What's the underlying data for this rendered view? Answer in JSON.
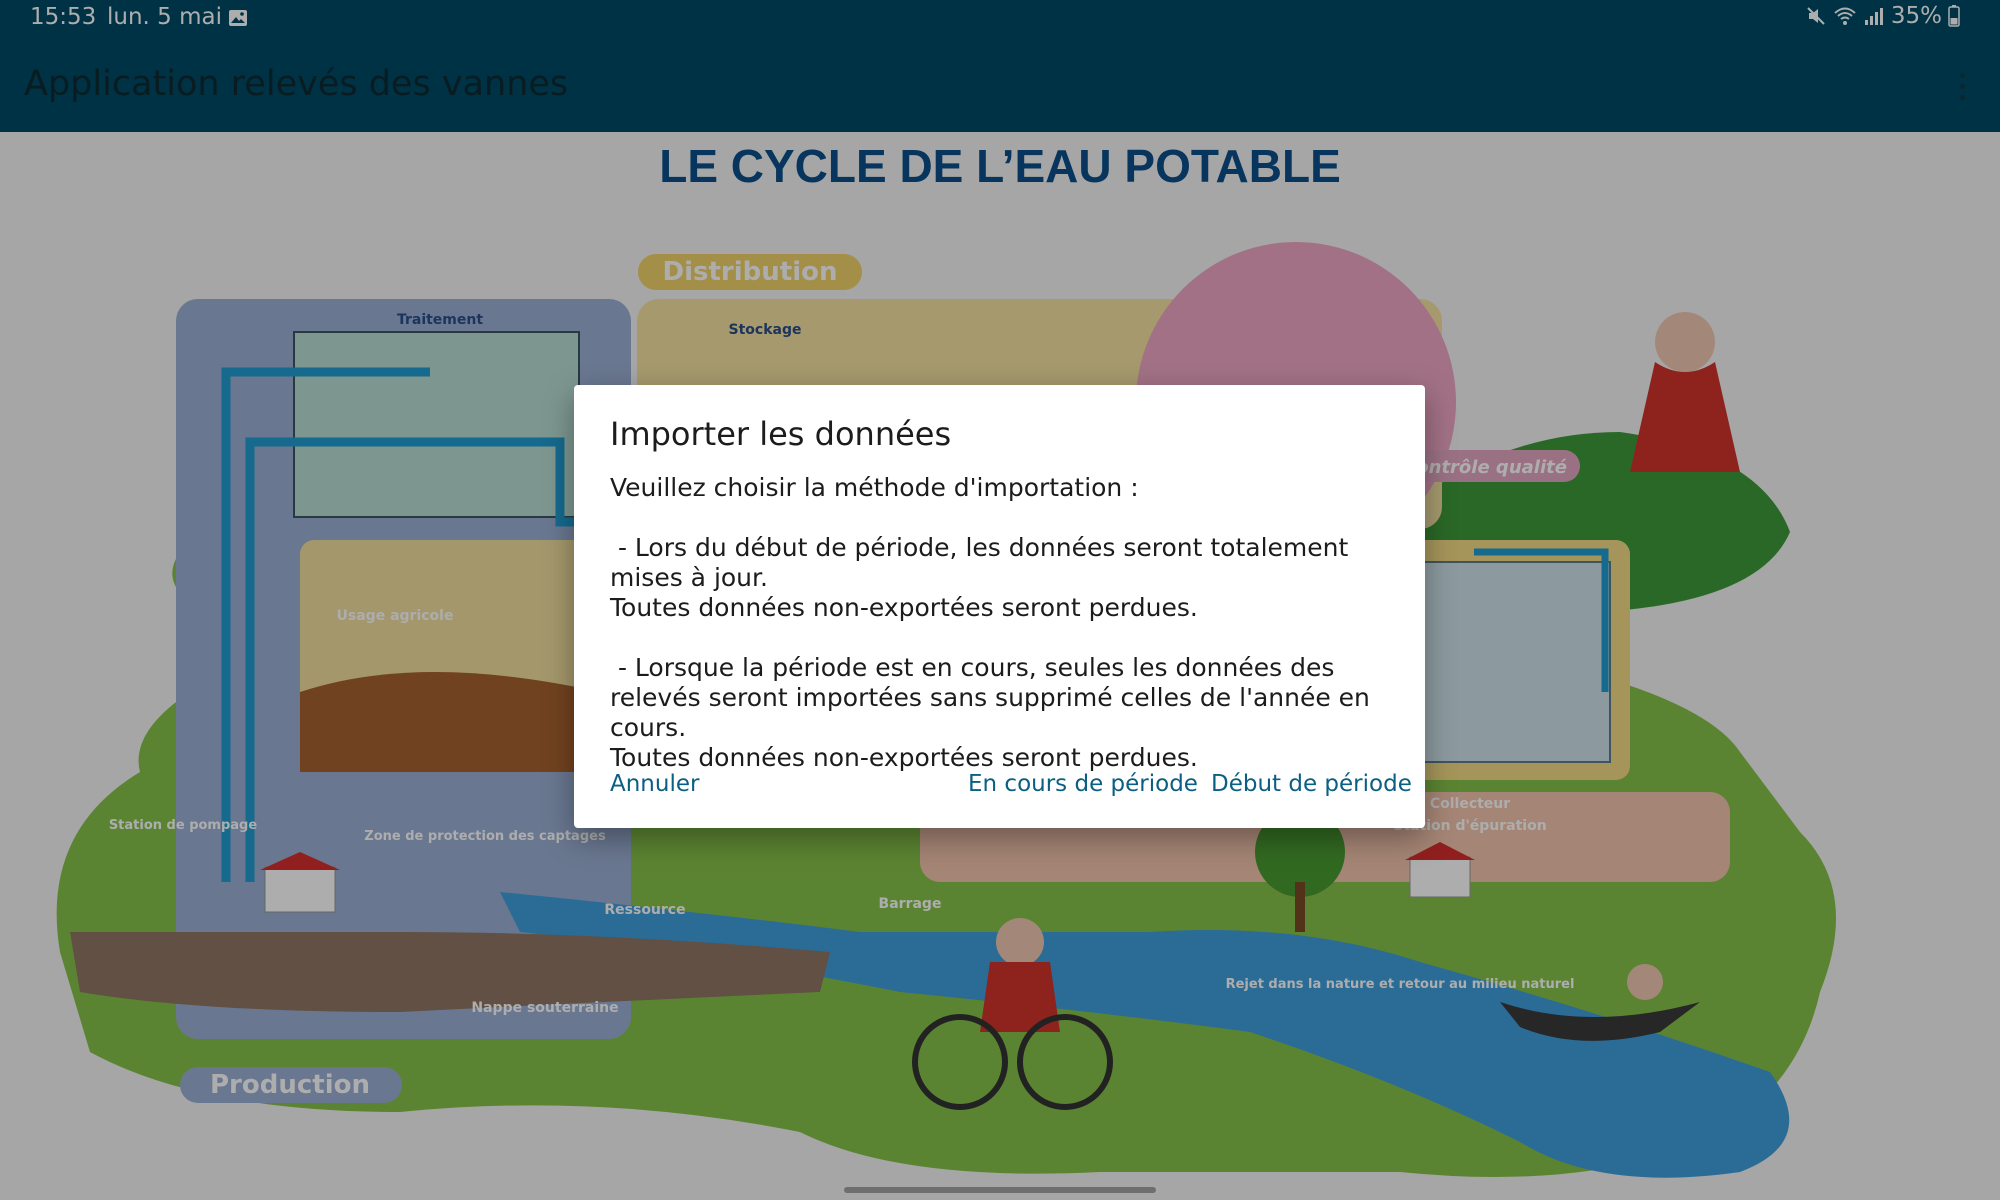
{
  "status_bar": {
    "time": "15:53",
    "date": "lun. 5 mai",
    "battery": "35%",
    "icons": [
      "gallery-icon",
      "mute-icon",
      "wifi-icon",
      "signal-icon",
      "battery-icon"
    ]
  },
  "app_bar": {
    "title": "Application relevés des vannes",
    "overflow_icon": "more-vert-icon"
  },
  "background_image": {
    "title": "LE CYCLE DE L’EAU POTABLE",
    "labels": {
      "distribution": "Distribution",
      "traitement": "Traitement",
      "stockage": "Stockage",
      "controle": "Contrôle qualité",
      "usage_agricole": "Usage agricole",
      "station": "Station de pompage",
      "zone": "Zone de protection des captages",
      "ressource": "Ressource",
      "barrage": "Barrage",
      "nappe": "Nappe souterraine",
      "production": "Production",
      "collecteur": "Collecteur",
      "epuration": "Station d'épuration",
      "rejet": "Rejet dans la nature et retour au milieu naturel"
    }
  },
  "dialog": {
    "title": "Importer les données",
    "message": "Veuillez choisir la méthode d'importation :\n\n - Lors du début de période, les données seront totalement mises à jour.\nToutes données non-exportées seront perdues.\n\n - Lorsque la période est en cours, seules les données des relevés seront importées sans supprimé celles de l'année en cours.\nToutes données non-exportées seront perdues.",
    "buttons": {
      "cancel": "Annuler",
      "current_period": "En cours de période",
      "start_period": "Début de période"
    }
  },
  "colors": {
    "header": "#004b66",
    "accent": "#0a5f82",
    "scrim": "rgba(0,0,0,0.32)"
  }
}
